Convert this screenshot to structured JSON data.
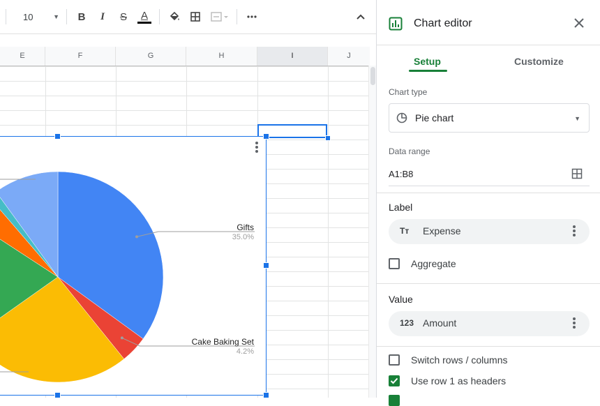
{
  "toolbar": {
    "font_size": "10",
    "bold_label": "B",
    "italic_label": "I",
    "strike_label": "S",
    "text_color_label": "A",
    "text_color": "#000000"
  },
  "grid": {
    "columns": [
      "E",
      "F",
      "G",
      "H",
      "I",
      "J"
    ],
    "selected_column": "I"
  },
  "chart_data": {
    "type": "pie",
    "title": "",
    "labels": [
      {
        "name": "Gifts",
        "pct": "35.0%"
      },
      {
        "name": "Cake Baking Set",
        "pct": "4.2%"
      }
    ],
    "slices": [
      {
        "value": 35.0,
        "color": "#4285f4"
      },
      {
        "value": 4.2,
        "color": "#ea4335"
      },
      {
        "value": 26.0,
        "color": "#fbbc04"
      },
      {
        "value": 19.0,
        "color": "#34a853"
      },
      {
        "value": 4.5,
        "color": "#ff6d01"
      },
      {
        "value": 1.3,
        "color": "#46bdc6"
      },
      {
        "value": 10.0,
        "color": "#7baaf7"
      }
    ]
  },
  "panel": {
    "title": "Chart editor",
    "tabs": [
      "Setup",
      "Customize"
    ],
    "active_tab": "Setup",
    "chart_type_caption": "Chart type",
    "chart_type_value": "Pie chart",
    "data_range_caption": "Data range",
    "data_range_value": "A1:B8",
    "label_section": "Label",
    "label_chip": "Expense",
    "label_chip_icon": "Tт",
    "aggregate_label": "Aggregate",
    "value_section": "Value",
    "value_chip": "Amount",
    "value_chip_icon": "123",
    "switch_label": "Switch rows / columns",
    "headers_label": "Use row 1 as headers",
    "accent": "#188038"
  }
}
